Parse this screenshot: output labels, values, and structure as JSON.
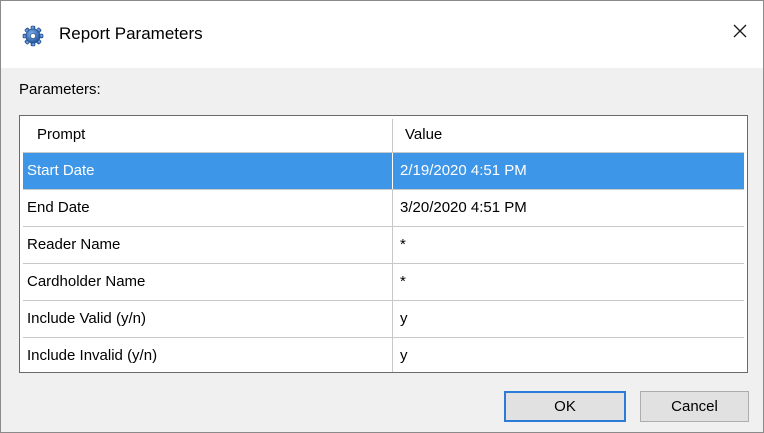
{
  "window": {
    "title": "Report Parameters",
    "icon": "gear-icon",
    "close_icon": "close-icon"
  },
  "parameters_label": "Parameters:",
  "grid": {
    "columns": [
      "Prompt",
      "Value"
    ],
    "rows": [
      {
        "prompt": "Start Date",
        "value": "2/19/2020 4:51 PM",
        "selected": true
      },
      {
        "prompt": "End Date",
        "value": "3/20/2020 4:51 PM",
        "selected": false
      },
      {
        "prompt": "Reader Name",
        "value": "*",
        "selected": false
      },
      {
        "prompt": "Cardholder Name",
        "value": "*",
        "selected": false
      },
      {
        "prompt": "Include Valid (y/n)",
        "value": "y",
        "selected": false
      },
      {
        "prompt": "Include Invalid (y/n)",
        "value": "y",
        "selected": false
      }
    ]
  },
  "buttons": {
    "ok_label": "OK",
    "cancel_label": "Cancel"
  },
  "colors": {
    "selection": "#3d96e8",
    "default_button_border": "#2a7cd6",
    "window_background": "#f0f0f0"
  }
}
